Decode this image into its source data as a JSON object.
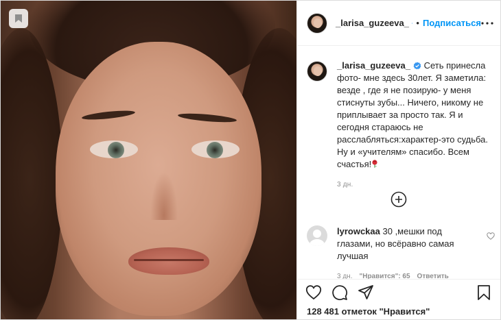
{
  "post": {
    "username": "_larisa_guzeeva_",
    "separator": "•",
    "follow_label": "Подписаться",
    "caption": "Сеть принесла фото- мне здесь 30лет. Я заметила: везде , где я не позирую- у меня стиснуты зубы... Ничего, никому не приплывает за просто так. Я и сегодня стараюсь не расслабляться:характер-это судьба. Ну и «учителям» спасибо. Всем счастья!",
    "caption_emoji": "rose-emoji",
    "timestamp": "3 дн.",
    "likes_text": "128 481 отметок \"Нравится\""
  },
  "comment": {
    "username": "lyrowckaa",
    "text": "30 ,мешки под глазами, но всёравно самая лучшая",
    "timestamp": "3 дн.",
    "likes": "\"Нравится\": 65",
    "reply_label": "Ответить"
  },
  "icons": {
    "bookmark_overlay": "bookmark-icon",
    "verified": "verified-badge-icon",
    "more": "more-options-icon",
    "load_more": "add-circle-icon",
    "like": "heart-icon",
    "comment": "comment-icon",
    "share": "share-icon",
    "save": "save-icon"
  },
  "colors": {
    "accent": "#0095f6",
    "text": "#262626",
    "secondary": "#8e8e8e",
    "border": "#dbdbdb",
    "rose": "#d62c35"
  }
}
